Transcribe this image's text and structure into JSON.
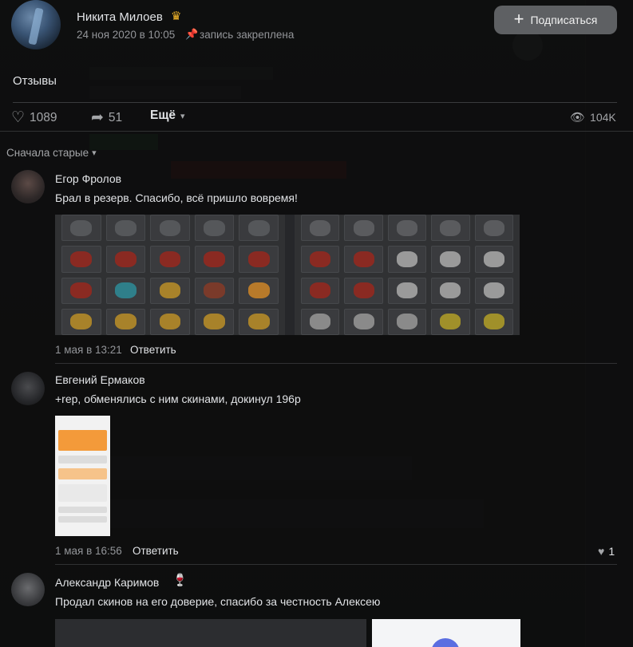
{
  "header": {
    "author_name": "Никита Милоев",
    "crown_icon": "crown-icon",
    "date": "24 ноя 2020 в 10:05",
    "pin_icon": "pin-icon",
    "pinned_label": "запись закреплена",
    "subscribe_label": "Подписаться"
  },
  "post": {
    "text": "Отзывы"
  },
  "actions": {
    "likes": "1089",
    "shares": "51",
    "more_label": "Ещё",
    "views": "104K"
  },
  "sort": {
    "label": "Сначала старые"
  },
  "comments": [
    {
      "author": "Егор Фролов",
      "text": "Брал в резерв. Спасибо, всё пришло вовремя!",
      "time": "1 мая в 13:21",
      "reply_label": "Ответить"
    },
    {
      "author": "Евгений Ермаков",
      "text": "+rep, обменялись с ним скинами, докинул 196р",
      "time": "1 мая в 16:56",
      "reply_label": "Ответить",
      "likes": "1"
    },
    {
      "author": "Александр Каримов",
      "emoji": "🍷",
      "text": "Продал скинов на его доверие, спасибо за честность Алексею"
    }
  ],
  "colors": {
    "background": "#141414",
    "text": "#e1e3e6",
    "muted": "#939599",
    "button": "#5e6063"
  }
}
